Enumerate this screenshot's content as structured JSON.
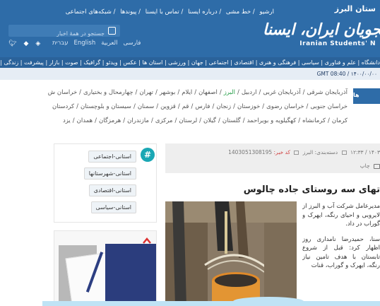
{
  "header": {
    "top_links": [
      "آرشیو",
      "خط مشی",
      "درباره ایسنا",
      "تماس با ایسنا",
      "پیوندها",
      "شبکه‌های اجتماعی"
    ],
    "search_placeholder": "جستجو در همهٔ اخبار",
    "languages": [
      "فارسی",
      "العربية",
      "English",
      "עברית"
    ],
    "social_icons": [
      "twitter-icon",
      "android-icon",
      "rss-icon"
    ],
    "brand_line1": "ستان البرز",
    "brand_line2": "شجویان ایران، ایسنا",
    "brand_line3": "Iranian Students' N",
    "category_bar": "دانشگاه | علم و فناوری | سیاسی | فرهنگی و هنری | اقتصادی | اجتماعی | جهان | ورزشی | استان ها | عکس | ویدئو | گرافیک | صوت | بازار | پیشرفت | زندگی | ایسنا"
  },
  "date_strip": {
    "gmt": "GMT 08:40  /  ۱۴۰۰/۰۰/۰۰"
  },
  "provinces": {
    "tab_label": "ها",
    "row1": [
      "آذربایجان شرقی",
      "آذربایجان غربی",
      "اردبیل",
      "البرز",
      "اصفهان",
      "ایلام",
      "بوشهر",
      "تهران",
      "چهارمحال و بختیاری",
      "خراسان ش"
    ],
    "row2": [
      "خراسان جنوبی",
      "خراسان رضوی",
      "خوزستان",
      "زنجان",
      "فارس",
      "قم",
      "قزوین",
      "سمنان",
      "سیستان و بلوچستان",
      "کردستان"
    ],
    "row3": [
      "کرمان",
      "کرمانشاه",
      "کهگیلویه و بویراحمد",
      "گلستان",
      "گیلان",
      "لرستان",
      "مرکزی",
      "مازندران",
      "هرمزگان",
      "همدان",
      "یزد"
    ],
    "highlight": "البرز"
  },
  "sidebar": {
    "badge": "#",
    "tags": [
      "استانی-اجتماعی",
      "استانی-شهرستانها",
      "استانی-اقتصادی",
      "استانی-سیاسی"
    ]
  },
  "article": {
    "date": "۱۴۰۳ / ۱۲:۳۳",
    "category_label": "دسته‌بندی: البرز",
    "news_code_label": "کد خبر:",
    "news_code": "1403051308195",
    "print_label": "چاپ",
    "title": "تهای سه روستای جاده چالوس",
    "paragraph1": "مدیرعامل شرکت آب و البرز از لایروبی و احیای رنگه، ایهرک و گوراب در داد.",
    "paragraph2": "سنا، حمیدرضا نامداری روز اظهار کرد: قبل از شروع تابستان با هدف تامین نیاز رنگه، ایهرک و گوراب، قنات"
  }
}
